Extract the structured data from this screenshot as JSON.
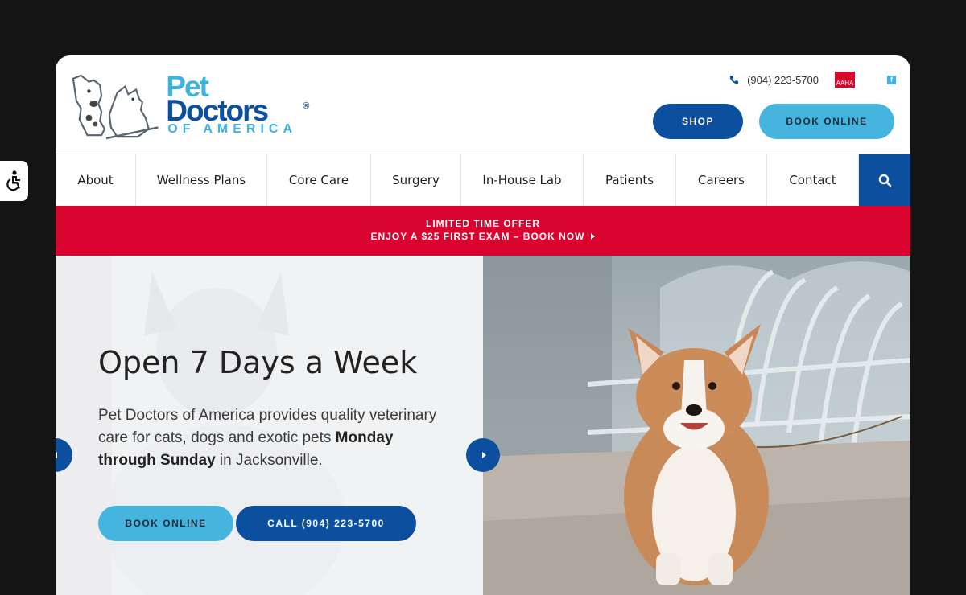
{
  "accessibility": {
    "icon": "wheelchair-icon"
  },
  "header": {
    "logo": {
      "line1": "Pet",
      "line2": "Doctors",
      "reg": "®",
      "line3": "OF AMERICA"
    },
    "phone": "(904) 223-5700",
    "aaha": "AAHA",
    "facebook": "f",
    "shop_label": "SHOP",
    "book_label": "BOOK ONLINE"
  },
  "nav": {
    "items": [
      {
        "label": "About"
      },
      {
        "label": "Wellness Plans"
      },
      {
        "label": "Core Care"
      },
      {
        "label": "Surgery"
      },
      {
        "label": "In-House Lab"
      },
      {
        "label": "Patients"
      },
      {
        "label": "Careers"
      },
      {
        "label": "Contact"
      }
    ],
    "search_icon": "search-icon"
  },
  "promo": {
    "line1": "LIMITED TIME OFFER",
    "line2": "ENJOY A $25 FIRST EXAM – BOOK NOW"
  },
  "hero": {
    "title": "Open 7 Days a Week",
    "body_start": "Pet Doctors of America provides quality veterinary care for cats, dogs and exotic pets ",
    "body_bold": "Monday through Sunday",
    "body_end": " in Jacksonville.",
    "book_label": "BOOK ONLINE",
    "call_label": "CALL (904) 223-5700"
  },
  "colors": {
    "navy": "#0d4f9f",
    "sky": "#45b5e0",
    "red": "#d9032f"
  }
}
